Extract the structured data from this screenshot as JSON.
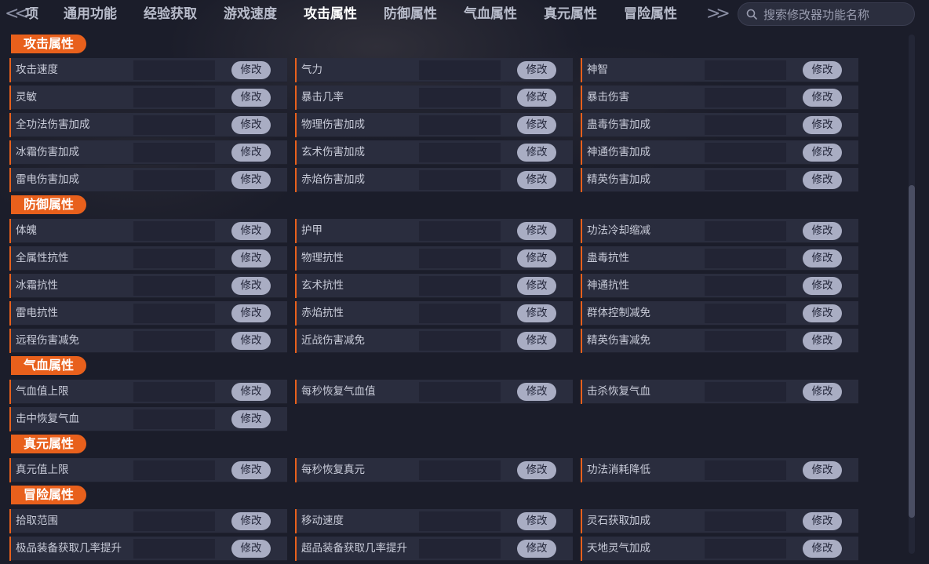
{
  "nav": {
    "left_arrow": "<<",
    "right_arrow": ">>",
    "tabs": [
      {
        "label": "项",
        "active": false
      },
      {
        "label": "通用功能",
        "active": false
      },
      {
        "label": "经验获取",
        "active": false
      },
      {
        "label": "游戏速度",
        "active": false
      },
      {
        "label": "攻击属性",
        "active": true
      },
      {
        "label": "防御属性",
        "active": false
      },
      {
        "label": "气血属性",
        "active": false
      },
      {
        "label": "真元属性",
        "active": false
      },
      {
        "label": "冒险属性",
        "active": false
      }
    ],
    "search_placeholder": "搜索修改器功能名称",
    "search_value": ""
  },
  "colors": {
    "accent": "#e8601c",
    "background": "#1b1d2a",
    "row_bg": "#2a2d3e",
    "button_bg": "#a9adc3"
  },
  "button_label": "修改",
  "sections": [
    {
      "title": "攻击属性",
      "rows": [
        [
          "攻击速度",
          "气力",
          "神智"
        ],
        [
          "灵敏",
          "暴击几率",
          "暴击伤害"
        ],
        [
          "全功法伤害加成",
          "物理伤害加成",
          "蛊毒伤害加成"
        ],
        [
          "冰霜伤害加成",
          "玄术伤害加成",
          "神通伤害加成"
        ],
        [
          "雷电伤害加成",
          "赤焰伤害加成",
          "精英伤害加成"
        ]
      ]
    },
    {
      "title": "防御属性",
      "rows": [
        [
          "体魄",
          "护甲",
          "功法冷却缩减"
        ],
        [
          "全属性抗性",
          "物理抗性",
          "蛊毒抗性"
        ],
        [
          "冰霜抗性",
          "玄术抗性",
          "神通抗性"
        ],
        [
          "雷电抗性",
          "赤焰抗性",
          "群体控制减免"
        ],
        [
          "远程伤害减免",
          "近战伤害减免",
          "精英伤害减免"
        ]
      ]
    },
    {
      "title": "气血属性",
      "rows": [
        [
          "气血值上限",
          "每秒恢复气血值",
          "击杀恢复气血"
        ],
        [
          "击中恢复气血"
        ]
      ]
    },
    {
      "title": "真元属性",
      "rows": [
        [
          "真元值上限",
          "每秒恢复真元",
          "功法消耗降低"
        ]
      ]
    },
    {
      "title": "冒险属性",
      "rows": [
        [
          "拾取范围",
          "移动速度",
          "灵石获取加成"
        ],
        [
          "极品装备获取几率提升",
          "超品装备获取几率提升",
          "天地灵气加成"
        ]
      ]
    }
  ]
}
